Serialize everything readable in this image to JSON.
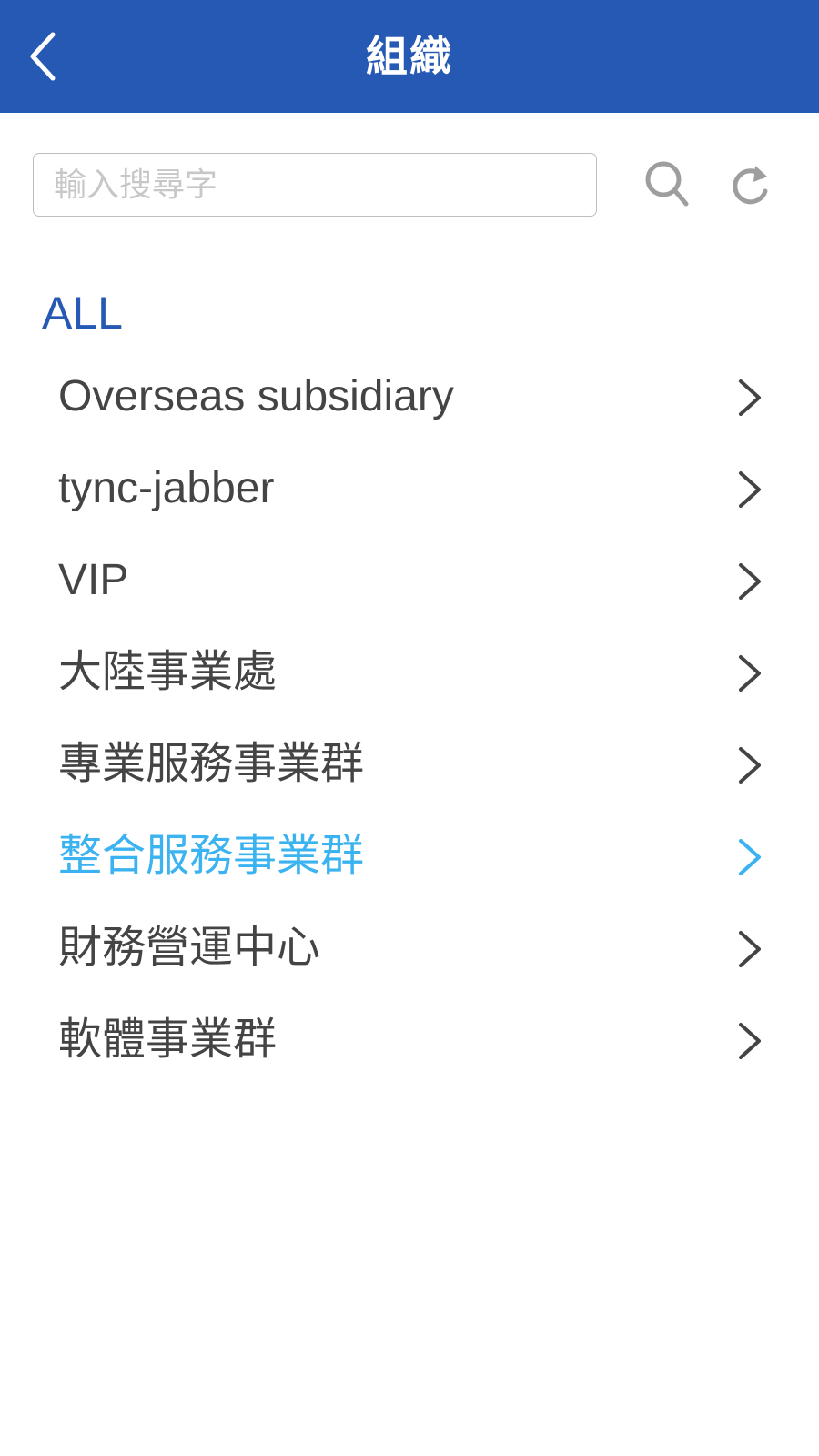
{
  "header": {
    "title": "組織",
    "back_icon": "chevron-left-icon"
  },
  "search": {
    "placeholder": "輸入搜尋字",
    "value": "",
    "search_icon": "search-icon",
    "refresh_icon": "refresh-icon"
  },
  "section": {
    "title": "ALL"
  },
  "org_list": {
    "items": [
      {
        "label": "Overseas subsidiary"
      },
      {
        "label": "tync-jabber"
      },
      {
        "label": "VIP"
      },
      {
        "label": "大陸事業處"
      },
      {
        "label": "專業服務事業群"
      },
      {
        "label": "整合服務事業群"
      },
      {
        "label": "財務營運中心"
      },
      {
        "label": "軟體事業群"
      }
    ],
    "chevron_icon": "chevron-right-icon"
  },
  "colors": {
    "header_bg": "#2659B4",
    "accent": "#2659B4",
    "highlight": "#3AB3F0",
    "text": "#444444",
    "placeholder": "#c7c7c7"
  }
}
